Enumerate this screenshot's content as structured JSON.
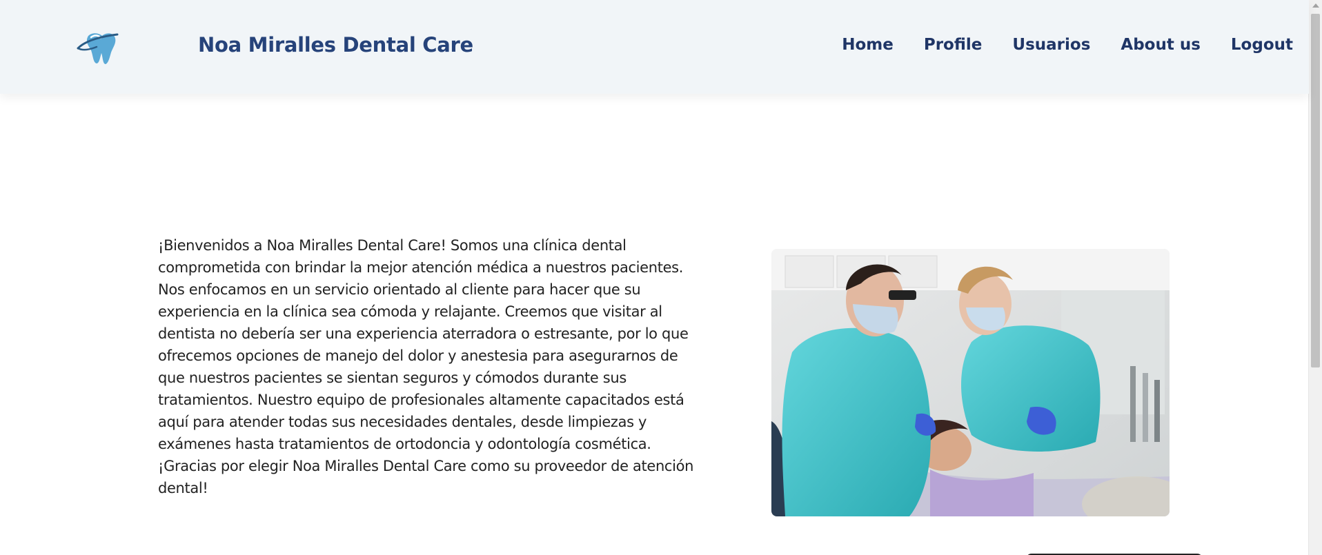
{
  "header": {
    "logo_icon": "tooth-logo-icon",
    "brand": "Noa Miralles Dental Care",
    "nav": [
      {
        "label": "Home"
      },
      {
        "label": "Profile"
      },
      {
        "label": "Usuarios"
      },
      {
        "label": "About us"
      },
      {
        "label": "Logout"
      }
    ]
  },
  "main": {
    "intro": "¡Bienvenidos a Noa Miralles Dental Care! Somos una clínica dental comprometida con brindar la mejor atención médica a nuestros pacientes. Nos enfocamos en un servicio orientado al cliente para hacer que su experiencia en la clínica sea cómoda y relajante. Creemos que visitar al dentista no debería ser una experiencia aterradora o estresante, por lo que ofrecemos opciones de manejo del dolor y anestesia para asegurarnos de que nuestros pacientes se sientan seguros y cómodos durante sus tratamientos. Nuestro equipo de profesionales altamente capacitados está aquí para atender todas sus necesidades dentales, desde limpiezas y exámenes hasta tratamientos de ortodoncia y odontología cosmética. ¡Gracias por elegir Noa Miralles Dental Care como su proveedor de atención dental!",
    "photo_icon": "dentists-treating-patient-photo"
  },
  "colors": {
    "header_bg": "#f1f5f8",
    "brand": "#26437a",
    "nav": "#1f3566",
    "scrubs": "#3fc2c9"
  }
}
